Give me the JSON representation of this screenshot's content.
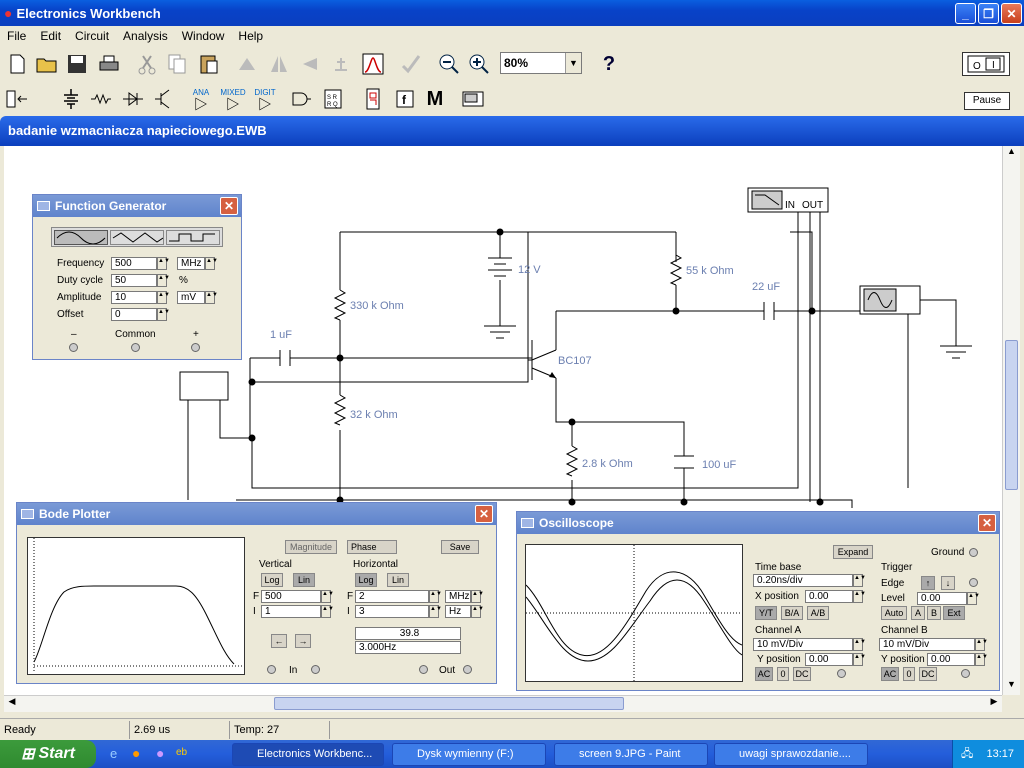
{
  "app": {
    "title": "Electronics Workbench",
    "doc_title": "badanie wzmacniacza napieciowego.EWB"
  },
  "menu": [
    "File",
    "Edit",
    "Circuit",
    "Analysis",
    "Window",
    "Help"
  ],
  "toolbar": {
    "zoom": "80%",
    "help": "?",
    "pause": "Pause",
    "ana": "ANA",
    "mixed": "MIXED",
    "digit": "DIGIT"
  },
  "circuit": {
    "r1": "330 k Ohm",
    "r2": "32 k Ohm",
    "r3": "55 k Ohm",
    "r4": "2.8 k Ohm",
    "c1": "1 uF",
    "c2": "22 uF",
    "c3": "100 uF",
    "battery": "12 V",
    "transistor": "BC107",
    "bode_in": "IN",
    "bode_out": "OUT"
  },
  "function_generator": {
    "title": "Function Generator",
    "freq_label": "Frequency",
    "freq": "500",
    "freq_unit": "MHz",
    "duty_label": "Duty cycle",
    "duty": "50",
    "duty_unit": "%",
    "amp_label": "Amplitude",
    "amp": "10",
    "amp_unit": "mV",
    "offset_label": "Offset",
    "offset": "0",
    "minus": "–",
    "common": "Common",
    "plus": "+"
  },
  "bode": {
    "title": "Bode Plotter",
    "magnitude": "Magnitude",
    "phase": "Phase",
    "save": "Save",
    "vertical": "Vertical",
    "horizontal": "Horizontal",
    "log": "Log",
    "lin": "Lin",
    "f_label": "F",
    "i_label": "I",
    "v_f": "500",
    "v_i": "1",
    "h_f": "2",
    "h_f_unit": "MHz",
    "h_i": "3",
    "h_i_unit": "Hz",
    "readout1": "39.8",
    "readout2": "3.000Hz",
    "in": "In",
    "out": "Out"
  },
  "oscilloscope": {
    "title": "Oscilloscope",
    "expand": "Expand",
    "ground": "Ground",
    "timebase": "Time base",
    "timebase_val": "0.20ns/div",
    "xpos_label": "X position",
    "xpos": "0.00",
    "yt": "Y/T",
    "ba": "B/A",
    "ab": "A/B",
    "trigger": "Trigger",
    "edge": "Edge",
    "level_label": "Level",
    "level": "0.00",
    "auto": "Auto",
    "a": "A",
    "b": "B",
    "ext": "Ext",
    "chA": "Channel A",
    "chA_val": "10 mV/Div",
    "chB": "Channel B",
    "chB_val": "10 mV/Div",
    "ypos_label": "Y position",
    "ypos": "0.00",
    "ac": "AC",
    "zero": "0",
    "dc": "DC"
  },
  "status": {
    "ready": "Ready",
    "time": "2.69 us",
    "temp": "Temp: 27"
  },
  "taskbar": {
    "start": "Start",
    "tasks": [
      "Electronics Workbenc...",
      "Dysk wymienny (F:)",
      "screen 9.JPG - Paint",
      "uwagi sprawozdanie...."
    ],
    "clock": "13:17"
  }
}
